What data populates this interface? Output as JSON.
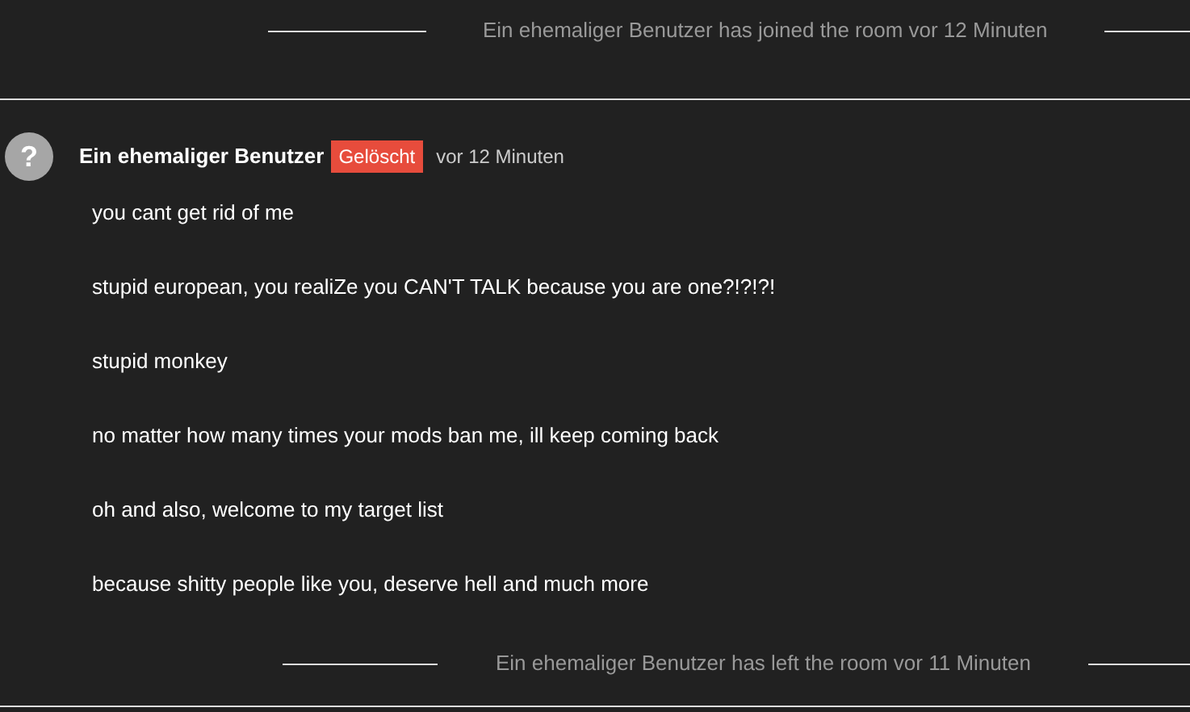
{
  "events_top": {
    "text": "Ein ehemaliger Benutzer has joined the room vor 12 Minuten"
  },
  "message_group": {
    "avatar": "?",
    "author": "Ein ehemaliger Benutzer",
    "badge": "Gelöscht",
    "time": "vor 12 Minuten",
    "messages": [
      "you cant get rid of me",
      "stupid european, you realiZe you CAN'T TALK because you are one?!?!?!",
      "stupid monkey",
      "no matter how many times your mods ban me, ill keep coming back",
      "oh and also, welcome to my target list",
      "because shitty people like you, deserve hell and much more"
    ]
  },
  "events_bottom": {
    "text": "Ein ehemaliger Benutzer has left the room vor 11 Minuten"
  }
}
